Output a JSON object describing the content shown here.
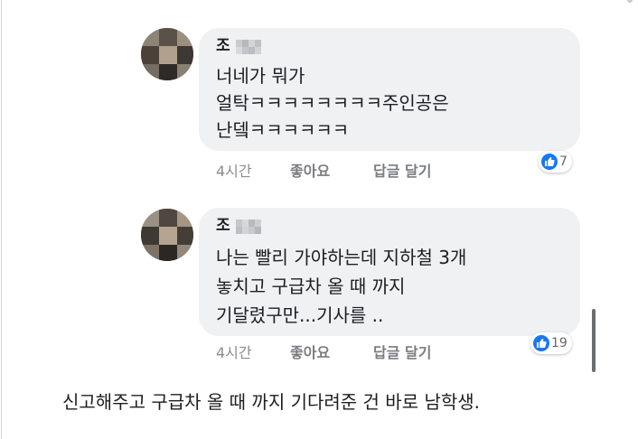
{
  "comments": [
    {
      "author": "조",
      "lines": [
        "너네가 뭐가",
        "얼탁ㅋㅋㅋㅋㅋㅋㅋㅋ주인공은",
        "난뎈ㅋㅋㅋㅋㅋㅋ"
      ],
      "time": "4시간",
      "like_label": "좋아요",
      "reply_label": "답글 달기",
      "reaction_count": "7"
    },
    {
      "author": "조",
      "lines": [
        "나는 빨리 가야하는데 지하철 3개",
        "놓치고 구급차 올 때 까지",
        "기달렸구만...기사를 .."
      ],
      "time": "4시간",
      "like_label": "좋아요",
      "reply_label": "답글 달기",
      "reaction_count": "19"
    }
  ],
  "caption": "신고해주고 구급차 올 때 까지 기다려준 건 바로 남학생.",
  "colors": {
    "bubble": "#eff1f3",
    "like_blue": "#1877f2",
    "meta_text": "#8a8d91"
  },
  "icons": [
    "like-icon"
  ]
}
